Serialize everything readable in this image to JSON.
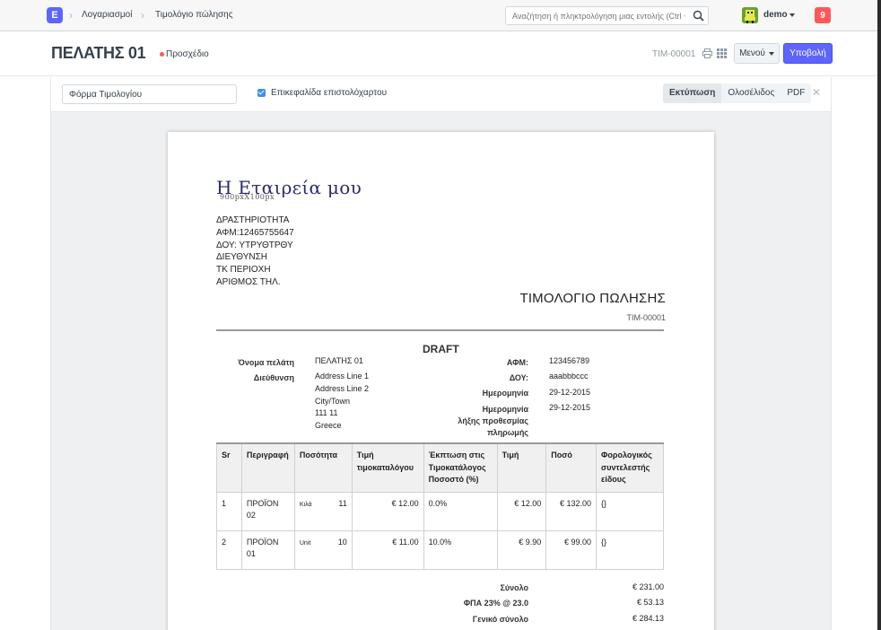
{
  "navbar": {
    "logo_letter": "E",
    "breadcrumbs": [
      "Λογαριασμοί",
      "Τιμολόγιο πώλησης"
    ],
    "search_placeholder": "Αναζήτηση ή πληκτρολόγηση μιας εντολής (Ctrl + G)",
    "user": "demo",
    "notifications": "9"
  },
  "page": {
    "title": "ΠΕΛΑΤΗΣ 01",
    "status": "Προσχέδιο",
    "doc_name": "TIM-00001",
    "menu_label": "Μενού",
    "submit_label": "Υποβολή"
  },
  "print_toolbar": {
    "format": "Φόρμα Τιμολογίου",
    "letterhead_label": "Επικεφαλίδα επιστολόχαρτου",
    "letterhead_checked": true,
    "buttons": [
      "Εκτύπωση",
      "Ολοσέλιδος",
      "PDF"
    ]
  },
  "invoice": {
    "company": "Η Εταιρεία μου",
    "logo_note": "900pxX100px",
    "address_lines": [
      "ΔΡΑΣΤΗΡΙΟΤΗΤΑ",
      "ΑΦΜ:12465755647",
      "ΔΟΥ: ΥΤΡΥΘΤΡΘΥ",
      "ΔΙΕΥΘΥΝΣΗ",
      "ΤΚ ΠΕΡΙΟΧΗ",
      "ΑΡΙΘΜΟΣ ΤΗΛ."
    ],
    "title": "ΤΙΜΟΛΟΓΙΟ ΠΩΛΗΣΗΣ",
    "number": "TIM-00001",
    "watermark": "DRAFT",
    "customer_label": "Όνομα πελάτη",
    "customer": "ΠΕΛΑΤΗΣ 01",
    "address_label": "Διεύθυνση",
    "address": [
      "Address Line 1",
      "Address Line 2",
      "City/Town",
      "111 11",
      "Greece"
    ],
    "afm_label": "ΑΦΜ:",
    "afm": "123456789",
    "doy_label": "ΔΟΥ:",
    "doy": "aaabbbccc",
    "date_label": "Ημερομηνία",
    "date": "29-12-2015",
    "due_label_lines": [
      "Ημερομηνία",
      "λήξης προθεσμίας",
      "πληρωμής"
    ],
    "due_date": "29-12-2015",
    "columns": [
      "Sr",
      "Περιγραφή",
      "Ποσότητα",
      "Τιμή τιμοκαταλόγου",
      "Έκπτωση στις Τιμοκατάλογος Ποσοστό (%)",
      "Τιμή",
      "Ποσό",
      "Φορολογικός συντελεστής είδους"
    ],
    "items": [
      {
        "sr": "1",
        "desc": "ΠΡΟΪΟΝ 02",
        "uom": "Κιλά",
        "qty": "11",
        "list_price": "€ 12.00",
        "discount": "0.0%",
        "rate": "€ 12.00",
        "amount": "€ 132.00",
        "tax": "{}"
      },
      {
        "sr": "2",
        "desc": "ΠΡΟΪΟΝ 01",
        "uom": "Unit",
        "qty": "10",
        "list_price": "€ 11.00",
        "discount": "10.0%",
        "rate": "€ 9.90",
        "amount": "€ 99.00",
        "tax": "{}"
      }
    ],
    "totals": [
      {
        "label": "Σύνολο",
        "value": "€ 231.00"
      },
      {
        "label": "ΦΠΑ 23% @ 23.0",
        "value": "€ 53.13"
      },
      {
        "label": "Γενικό σύνολο",
        "value": "€ 284.13"
      }
    ]
  },
  "colors": {
    "primary": "#5e64ff",
    "danger": "#ff5858",
    "checkbox": "#3e8df0",
    "company": "#2c2c6e"
  }
}
